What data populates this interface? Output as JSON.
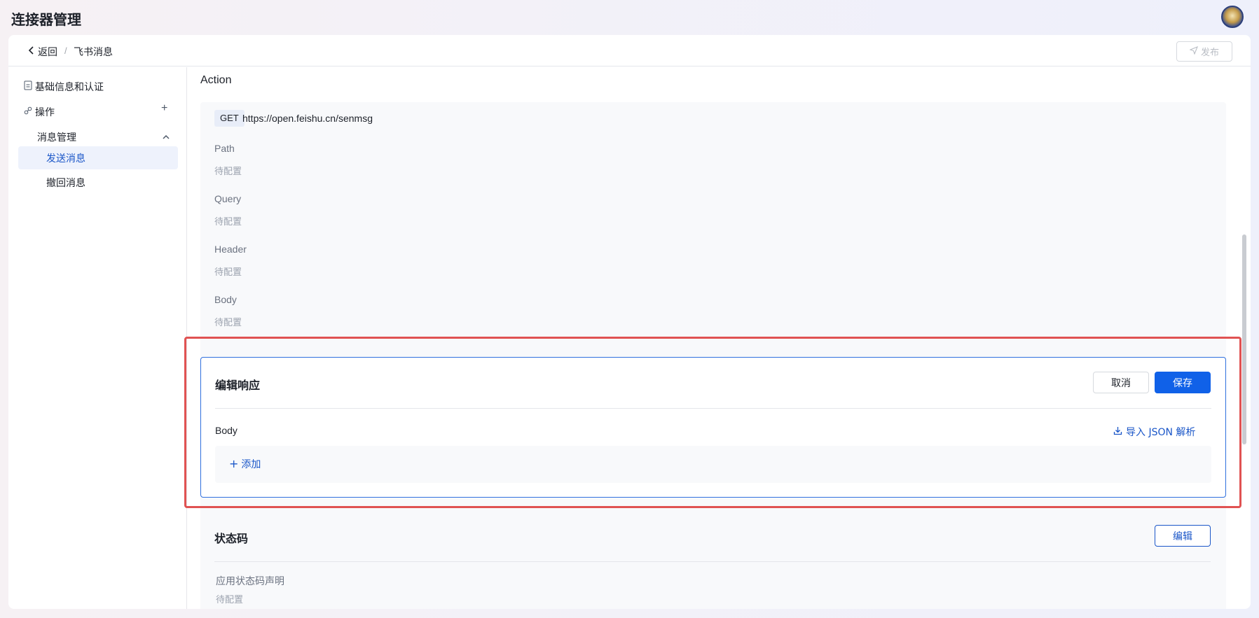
{
  "app": {
    "title": "连接器管理"
  },
  "topbar": {
    "back_label": "返回",
    "separator": "/",
    "current": "飞书消息",
    "publish_label": "发布"
  },
  "sidebar": {
    "basic_info": "基础信息和认证",
    "operations": "操作",
    "group": "消息管理",
    "items": [
      {
        "label": "发送消息",
        "active": true
      },
      {
        "label": "撤回消息",
        "active": false
      }
    ]
  },
  "main": {
    "section_title": "Action",
    "request": {
      "method": "GET",
      "url": "https://open.feishu.cn/senmsg",
      "fields": [
        {
          "label": "Path",
          "value": "待配置"
        },
        {
          "label": "Query",
          "value": "待配置"
        },
        {
          "label": "Header",
          "value": "待配置"
        },
        {
          "label": "Body",
          "value": "待配置"
        }
      ]
    },
    "response_editor": {
      "title": "编辑响应",
      "cancel_label": "取消",
      "save_label": "保存",
      "body_label": "Body",
      "import_label": "导入 JSON 解析",
      "add_label": "添加"
    },
    "status_code": {
      "title": "状态码",
      "edit_label": "编辑",
      "declaration_label": "应用状态码声明",
      "declaration_value": "待配置"
    }
  },
  "colors": {
    "accent": "#1061e8",
    "highlight_border": "#e05252"
  }
}
